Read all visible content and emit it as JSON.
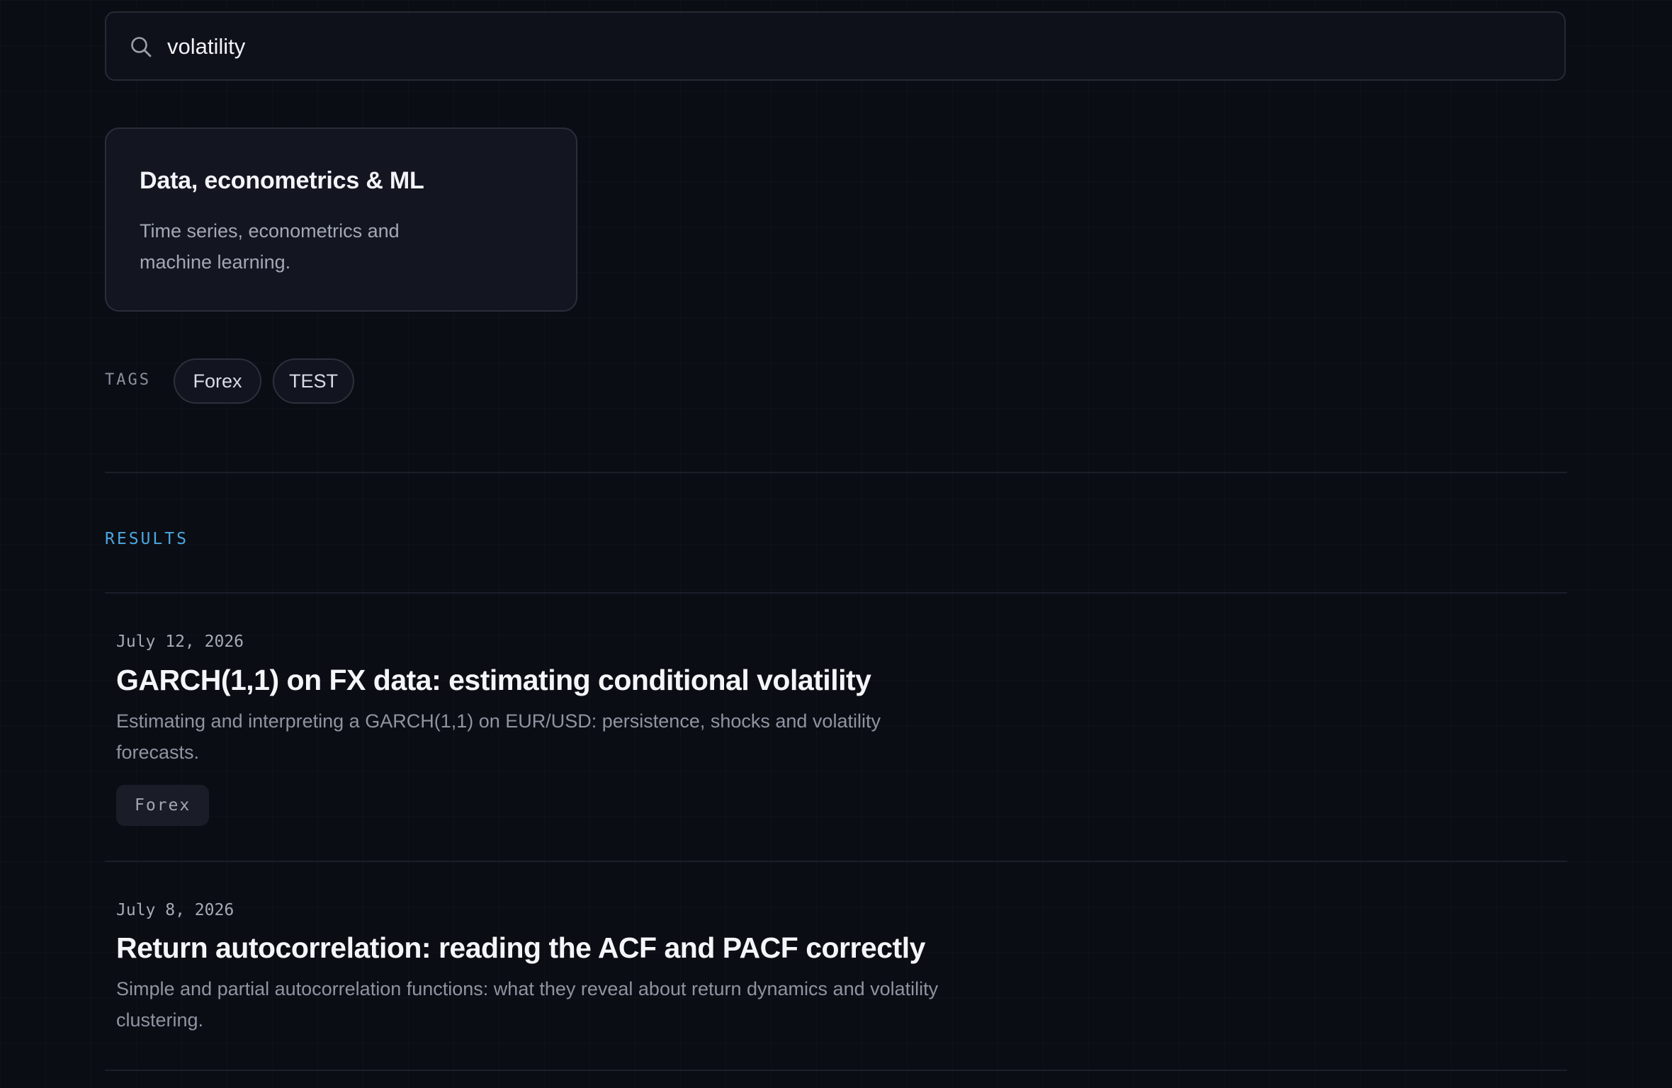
{
  "search": {
    "value": "volatility"
  },
  "category": {
    "title": "Data, econometrics & ML",
    "description": "Time series, econometrics and machine learning."
  },
  "tags": {
    "label": "TAGS",
    "items": [
      "Forex",
      "TEST"
    ]
  },
  "results": {
    "heading": "RESULTS",
    "items": [
      {
        "date": "July 12, 2026",
        "title": "GARCH(1,1) on FX data: estimating conditional volatility",
        "excerpt": "Estimating and interpreting a GARCH(1,1) on EUR/USD: persistence, shocks and volatility forecasts.",
        "tag": "Forex"
      },
      {
        "date": "July 8, 2026",
        "title": "Return autocorrelation: reading the ACF and PACF correctly",
        "excerpt": "Simple and partial autocorrelation functions: what they reveal about return dynamics and volatility clustering."
      }
    ]
  },
  "colors": {
    "background": "#0b0d14",
    "accent": "#4aa8e0",
    "card": "#131621"
  },
  "icons": {
    "search": "search-icon"
  }
}
